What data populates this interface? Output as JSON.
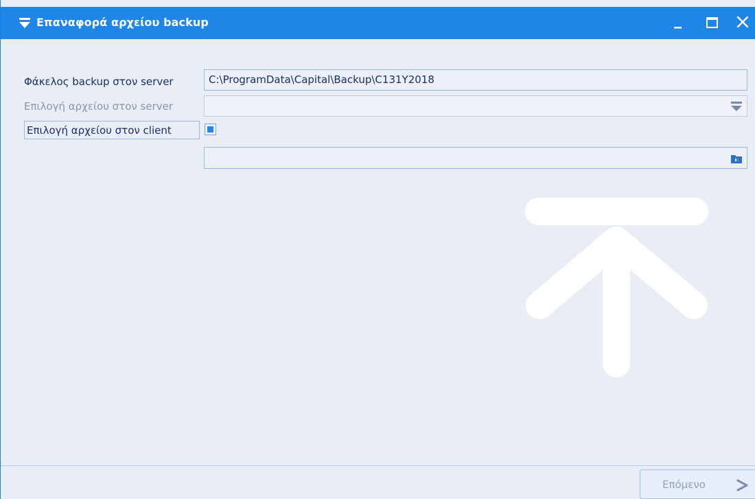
{
  "window": {
    "title": "Επαναφορά αρχείου backup",
    "controls": [
      "minimize",
      "maximize",
      "close"
    ]
  },
  "form": {
    "server_folder": {
      "label": "Φάκελος backup στον server",
      "value": "C:\\ProgramData\\Capital\\Backup\\C131Y2018"
    },
    "server_file": {
      "label": "Επιλογή αρχείου στον server",
      "value": ""
    },
    "client_file": {
      "label": "Επιλογή αρχείου στον client",
      "checked": true,
      "path_value": ""
    }
  },
  "footer": {
    "next_label": "Επόμενο"
  },
  "colors": {
    "titlebar": "#1f86e8",
    "accent": "#2586e5",
    "background": "#e9edf6",
    "label_text": "#1a2f66"
  }
}
